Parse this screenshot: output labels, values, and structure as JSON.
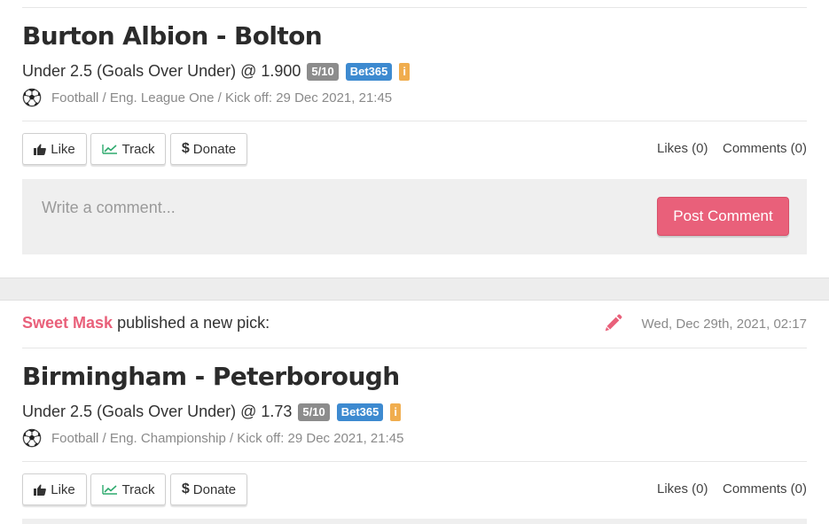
{
  "picks": [
    {
      "match": "Burton Albion - Bolton",
      "pick": "Under 2.5 (Goals Over Under) @ 1.900",
      "stake": "5/10",
      "bookmaker": "Bet365",
      "info": "i",
      "meta": "Football / Eng. League One / Kick off: 29 Dec 2021, 21:45",
      "like_label": "Like",
      "track_label": "Track",
      "donate_label": "Donate",
      "likes": "Likes (0)",
      "comments": "Comments (0)",
      "comment_placeholder": "Write a comment...",
      "post_label": "Post Comment"
    },
    {
      "publisher": "Sweet Mask",
      "published_text": "published a new pick:",
      "date": "Wed, Dec 29th, 2021, 02:17",
      "match": "Birmingham - Peterborough",
      "pick": "Under 2.5 (Goals Over Under) @ 1.73",
      "stake": "5/10",
      "bookmaker": "Bet365",
      "info": "i",
      "meta": "Football / Eng. Championship / Kick off: 29 Dec 2021, 21:45",
      "like_label": "Like",
      "track_label": "Track",
      "donate_label": "Donate",
      "likes": "Likes (0)",
      "comments": "Comments (0)"
    }
  ],
  "icons": {
    "like": "thumbs-up-icon",
    "track": "trend-line-icon",
    "donate": "dollar-icon",
    "sport": "soccer-ball-icon",
    "edit": "pencil-icon"
  },
  "colors": {
    "accent": "#e9607a",
    "bookmaker_badge": "#3d8ad0",
    "stake_badge": "#8c8c8c",
    "info_badge": "#f0ad4e",
    "track_icon": "#2eaa6e"
  },
  "symbols": {
    "dollar": "$"
  }
}
